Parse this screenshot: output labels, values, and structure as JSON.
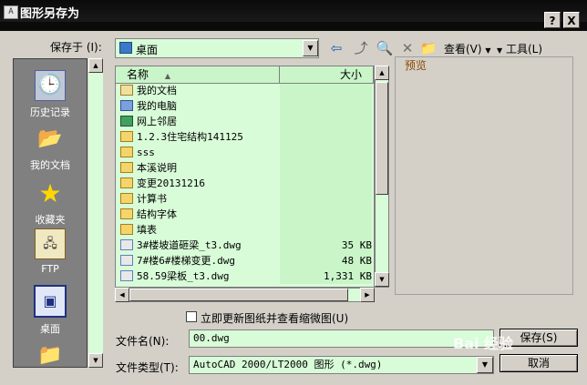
{
  "window": {
    "title": "图形另存为",
    "help_label": "?",
    "close_label": "X"
  },
  "toolbar": {
    "save_in_label": "保存于 (I):",
    "save_in_value": "桌面",
    "view_label": "查看(V)",
    "tools_label": "工具(L)"
  },
  "places": [
    {
      "label": "历史记录",
      "icon": "history-icon"
    },
    {
      "label": "我的文档",
      "icon": "my-documents-icon"
    },
    {
      "label": "收藏夹",
      "icon": "favorites-star-icon"
    },
    {
      "label": "FTP",
      "icon": "ftp-icon"
    },
    {
      "label": "桌面",
      "icon": "desktop-icon"
    }
  ],
  "file_list": {
    "columns": {
      "name": "名称",
      "size": "大小"
    },
    "rows": [
      {
        "name": "我的文档",
        "size": "",
        "icon": "folder-docs"
      },
      {
        "name": "我的电脑",
        "size": "",
        "icon": "computer"
      },
      {
        "name": "网上邻居",
        "size": "",
        "icon": "network"
      },
      {
        "name": "1.2.3住宅结构141125",
        "size": "",
        "icon": "folder"
      },
      {
        "name": "sss",
        "size": "",
        "icon": "folder"
      },
      {
        "name": "本溪说明",
        "size": "",
        "icon": "folder"
      },
      {
        "name": "变更20131216",
        "size": "",
        "icon": "folder"
      },
      {
        "name": "计算书",
        "size": "",
        "icon": "folder"
      },
      {
        "name": "结构字体",
        "size": "",
        "icon": "folder"
      },
      {
        "name": "填表",
        "size": "",
        "icon": "folder"
      },
      {
        "name": "3#楼坡道砸梁_t3.dwg",
        "size": "35 KB",
        "icon": "dwg"
      },
      {
        "name": "7#楼6#楼梯变更.dwg",
        "size": "48 KB",
        "icon": "dwg"
      },
      {
        "name": "58.59梁板_t3.dwg",
        "size": "1,331 KB",
        "icon": "dwg"
      }
    ]
  },
  "preview": {
    "title": "预览"
  },
  "options": {
    "update_thumbnail_label": "立即更新图纸并查看缩微图(U)"
  },
  "filename": {
    "label": "文件名(N):",
    "value": "00.dwg"
  },
  "filetype": {
    "label": "文件类型(T):",
    "value": "AutoCAD 2000/LT2000 图形 (*.dwg)"
  },
  "buttons": {
    "save": "保存(S)",
    "cancel": "取消"
  },
  "watermark": "Bai 经验"
}
